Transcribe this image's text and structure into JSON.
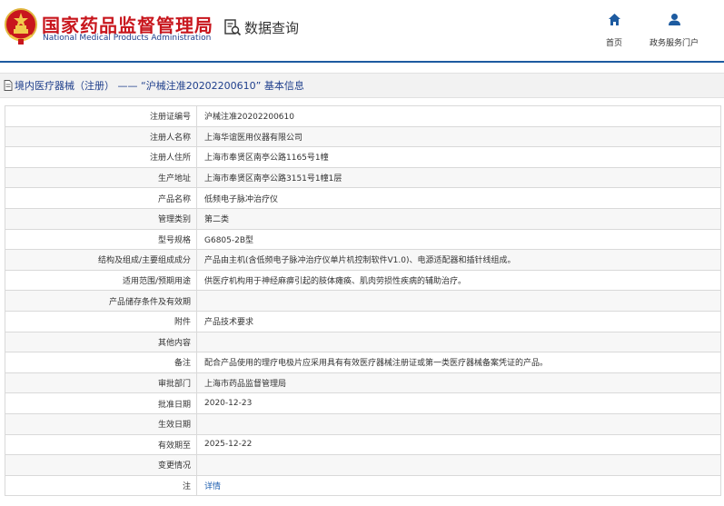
{
  "header": {
    "title_cn": "国家药品监督管理局",
    "title_en": "National Medical Products Administration",
    "query_label": "数据查询",
    "nav": {
      "home": "首页",
      "portal": "政务服务门户"
    }
  },
  "page": {
    "title": "境内医疗器械（注册） —— “沪械注准20202200610” 基本信息"
  },
  "colors": {
    "brand_red": "#c8161d",
    "brand_blue": "#1d5ba0",
    "link_blue": "#1f5fb0"
  },
  "icons": [
    "national-emblem-icon",
    "data-query-icon",
    "home-icon",
    "user-icon",
    "document-icon"
  ],
  "details": [
    {
      "label": "注册证编号",
      "value": "沪械注准20202200610"
    },
    {
      "label": "注册人名称",
      "value": "上海华谊医用仪器有限公司"
    },
    {
      "label": "注册人住所",
      "value": "上海市奉贤区南亭公路1165号1幢"
    },
    {
      "label": "生产地址",
      "value": "上海市奉贤区南亭公路3151号1幢1层"
    },
    {
      "label": "产品名称",
      "value": "低频电子脉冲治疗仪"
    },
    {
      "label": "管理类别",
      "value": "第二类"
    },
    {
      "label": "型号规格",
      "value": "G6805-2B型"
    },
    {
      "label": "结构及组成/主要组成成分",
      "value": "产品由主机(含低频电子脉冲治疗仪单片机控制软件V1.0)、电源适配器和插针线组成。"
    },
    {
      "label": "适用范围/预期用途",
      "value": "供医疗机构用于神经麻痹引起的肢体瘫痪、肌肉劳损性疾病的辅助治疗。"
    },
    {
      "label": "产品储存条件及有效期",
      "value": ""
    },
    {
      "label": "附件",
      "value": "产品技术要求"
    },
    {
      "label": "其他内容",
      "value": ""
    },
    {
      "label": "备注",
      "value": "配合产品使用的理疗电极片应采用具有有效医疗器械注册证或第一类医疗器械备案凭证的产品。"
    },
    {
      "label": "审批部门",
      "value": "上海市药品监督管理局"
    },
    {
      "label": "批准日期",
      "value": "2020-12-23"
    },
    {
      "label": "生效日期",
      "value": ""
    },
    {
      "label": "有效期至",
      "value": "2025-12-22"
    },
    {
      "label": "变更情况",
      "value": ""
    },
    {
      "label": "注",
      "value": "详情"
    }
  ]
}
